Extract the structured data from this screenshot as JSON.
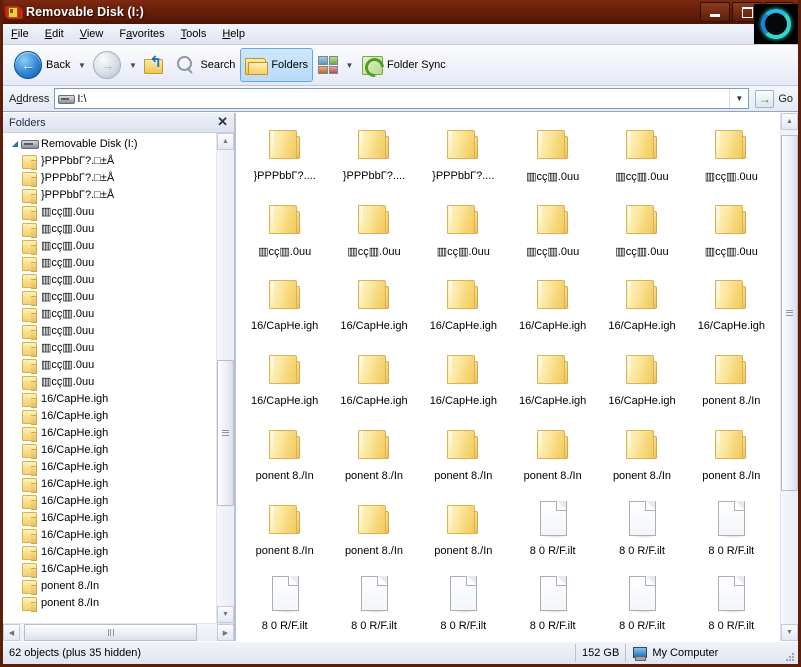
{
  "window": {
    "title": "Removable Disk (I:)",
    "icon": "removable-disk-icon",
    "buttons": {
      "minimize": "minimize",
      "maximize": "maximize",
      "close": "close"
    }
  },
  "menubar": {
    "items": [
      {
        "label": "File",
        "accel": "F"
      },
      {
        "label": "Edit",
        "accel": "E"
      },
      {
        "label": "View",
        "accel": "V"
      },
      {
        "label": "Favorites",
        "accel": "a"
      },
      {
        "label": "Tools",
        "accel": "T"
      },
      {
        "label": "Help",
        "accel": "H"
      }
    ],
    "logo": "teal-ring-logo"
  },
  "toolbar": {
    "back_label": "Back",
    "back_icon": "back-arrow-icon",
    "back_dropdown_icon": "chevron-down-icon",
    "forward_icon": "forward-arrow-icon",
    "forward_dropdown_icon": "chevron-down-icon",
    "up_icon": "up-folder-icon",
    "search_label": "Search",
    "search_icon": "magnifier-icon",
    "folders_label": "Folders",
    "folders_icon": "folders-icon",
    "folders_pressed": true,
    "views_icon": "views-icon",
    "views_dropdown_icon": "chevron-down-icon",
    "foldersync_label": "Folder Sync",
    "foldersync_icon": "folder-sync-icon"
  },
  "address": {
    "label": "Address",
    "value": "I:\\",
    "icon": "removable-drive-icon",
    "dropdown_icon": "chevron-down-icon",
    "go_label": "Go",
    "go_icon": "go-arrow-icon"
  },
  "tree": {
    "header": "Folders",
    "close_icon": "close-icon",
    "root": {
      "label": "Removable Disk (I:)",
      "icon": "drive-icon",
      "expander": "expanded-triangle"
    },
    "items": [
      "}PPPbbΓ?.□±Å",
      "}PPPbbΓ?.□±Å",
      "}PPPbbΓ?.□±Å",
      "▥cç▥.0uu",
      "▥cç▥.0uu",
      "▥cç▥.0uu",
      "▥cç▥.0uu",
      "▥cç▥.0uu",
      "▥cç▥.0uu",
      "▥cç▥.0uu",
      "▥cç▥.0uu",
      "▥cç▥.0uu",
      "▥cç▥.0uu",
      "▥cç▥.0uu",
      "16/CapHe.igh",
      "16/CapHe.igh",
      "16/CapHe.igh",
      "16/CapHe.igh",
      "16/CapHe.igh",
      "16/CapHe.igh",
      "16/CapHe.igh",
      "16/CapHe.igh",
      "16/CapHe.igh",
      "16/CapHe.igh",
      "16/CapHe.igh",
      "ponent 8./In",
      "ponent 8./In"
    ],
    "vscroll": {
      "up_icon": "scroll-up-arrow",
      "down_icon": "scroll-down-arrow",
      "thumb_top_pct": 46,
      "thumb_height_pct": 32
    },
    "hscroll": {
      "left_icon": "scroll-left-arrow",
      "right_icon": "scroll-right-arrow",
      "thumb_left_pct": 2,
      "thumb_width_pct": 88
    }
  },
  "files": {
    "items": [
      {
        "name": "}PPPbbΓ?....",
        "type": "folder"
      },
      {
        "name": "}PPPbbΓ?....",
        "type": "folder"
      },
      {
        "name": "}PPPbbΓ?....",
        "type": "folder"
      },
      {
        "name": "▥cç▥.0uu",
        "type": "folder"
      },
      {
        "name": "▥cç▥.0uu",
        "type": "folder"
      },
      {
        "name": "▥cç▥.0uu",
        "type": "folder"
      },
      {
        "name": "▥cç▥.0uu",
        "type": "folder"
      },
      {
        "name": "▥cç▥.0uu",
        "type": "folder"
      },
      {
        "name": "▥cç▥.0uu",
        "type": "folder"
      },
      {
        "name": "▥cç▥.0uu",
        "type": "folder"
      },
      {
        "name": "▥cç▥.0uu",
        "type": "folder"
      },
      {
        "name": "▥cç▥.0uu",
        "type": "folder"
      },
      {
        "name": "16/CapHe.igh",
        "type": "folder"
      },
      {
        "name": "16/CapHe.igh",
        "type": "folder"
      },
      {
        "name": "16/CapHe.igh",
        "type": "folder"
      },
      {
        "name": "16/CapHe.igh",
        "type": "folder"
      },
      {
        "name": "16/CapHe.igh",
        "type": "folder"
      },
      {
        "name": "16/CapHe.igh",
        "type": "folder"
      },
      {
        "name": "16/CapHe.igh",
        "type": "folder"
      },
      {
        "name": "16/CapHe.igh",
        "type": "folder"
      },
      {
        "name": "16/CapHe.igh",
        "type": "folder"
      },
      {
        "name": "16/CapHe.igh",
        "type": "folder"
      },
      {
        "name": "16/CapHe.igh",
        "type": "folder"
      },
      {
        "name": "ponent 8./In",
        "type": "folder"
      },
      {
        "name": "ponent 8./In",
        "type": "folder"
      },
      {
        "name": "ponent 8./In",
        "type": "folder"
      },
      {
        "name": "ponent 8./In",
        "type": "folder"
      },
      {
        "name": "ponent 8./In",
        "type": "folder"
      },
      {
        "name": "ponent 8./In",
        "type": "folder"
      },
      {
        "name": "ponent 8./In",
        "type": "folder"
      },
      {
        "name": "ponent 8./In",
        "type": "folder"
      },
      {
        "name": "ponent 8./In",
        "type": "folder"
      },
      {
        "name": "ponent 8./In",
        "type": "folder"
      },
      {
        "name": "8 0 R/F.ilt",
        "type": "file"
      },
      {
        "name": "8 0 R/F.ilt",
        "type": "file"
      },
      {
        "name": "8 0 R/F.ilt",
        "type": "file"
      },
      {
        "name": "8 0 R/F.ilt",
        "type": "file"
      },
      {
        "name": "8 0 R/F.ilt",
        "type": "file"
      },
      {
        "name": "8 0 R/F.ilt",
        "type": "file"
      },
      {
        "name": "8 0 R/F.ilt",
        "type": "file"
      },
      {
        "name": "8 0 R/F.ilt",
        "type": "file"
      },
      {
        "name": "8 0 R/F.ilt",
        "type": "file"
      }
    ],
    "vscroll": {
      "up_icon": "scroll-up-arrow",
      "down_icon": "scroll-down-arrow",
      "thumb_top_pct": 1,
      "thumb_height_pct": 72
    }
  },
  "statusbar": {
    "objects": "62 objects (plus 35 hidden)",
    "size": "152 GB",
    "computer": "My Computer",
    "computer_icon": "my-computer-icon",
    "resize_grip": "resize-grip"
  }
}
